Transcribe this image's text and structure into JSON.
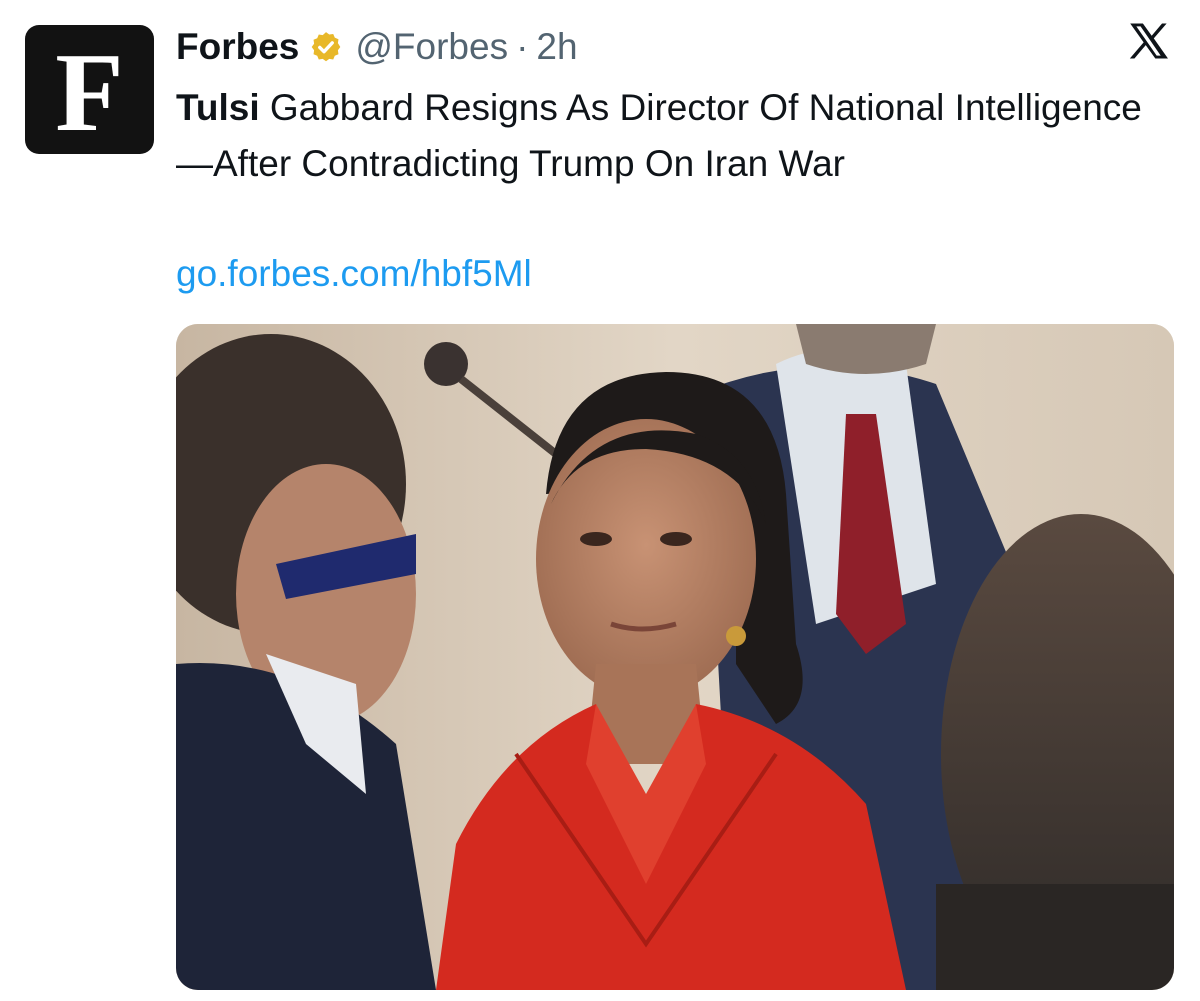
{
  "tweet": {
    "author_name": "Forbes",
    "avatar_letter": "F",
    "verified_icon": "gold-verified-badge-icon",
    "handle": "@Forbes",
    "separator": "·",
    "time": "2h",
    "headline_bold": "Tulsi",
    "headline_rest": " Gabbard Resigns As Director Of National Intelligence—After Contradicting Trump On Iran War",
    "link_text": "go.forbes.com/hbf5Ml",
    "platform_icon": "x-logo-icon",
    "media_alt": "Photo of Tulsi Gabbard in a red blazer at an event, with men in suits around her"
  },
  "colors": {
    "text": "#0f1419",
    "secondary": "#536471",
    "link": "#1d9bf0",
    "verified_gold": "#e8b829",
    "avatar_bg": "#121212",
    "blazer_red": "#d42a1f"
  }
}
